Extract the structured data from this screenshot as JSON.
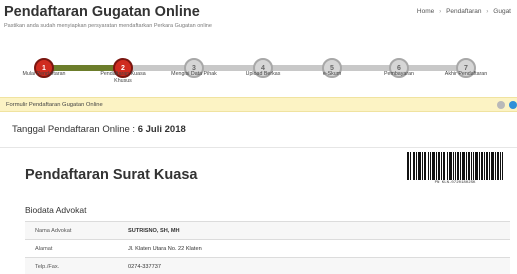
{
  "header": {
    "title": "Pendaftaran Gugatan Online",
    "subtitle": "Pastikan anda sudah menyiapkan persyaratan mendaftarkan Perkara Gugatan online",
    "breadcrumb": [
      "Home",
      "Pendaftaran",
      "Gugat"
    ]
  },
  "steps": [
    {
      "number": "1",
      "label": "Mulai Pendaftaran",
      "done": true
    },
    {
      "number": "2",
      "label": "Pendaftaran Kuasa Khusus",
      "done": true
    },
    {
      "number": "3",
      "label": "Mengisi Data Pihak",
      "done": false
    },
    {
      "number": "4",
      "label": "Upload Berkas",
      "done": false
    },
    {
      "number": "5",
      "label": "e-Skum",
      "done": false
    },
    {
      "number": "6",
      "label": "Pembayaran",
      "done": false
    },
    {
      "number": "7",
      "label": "Akhir Pendaftaran",
      "done": false
    }
  ],
  "form_bar": {
    "title": "Formulir Pendaftaran Gugatan Online"
  },
  "registration": {
    "date_label": "Tanggal Pendaftaran Online :",
    "date_value": "6 Juli 2018"
  },
  "section": {
    "title": "Pendaftaran Surat Kuasa",
    "barcode_text": "PN KLN-07201802SK",
    "sub_heading": "Biodata Advokat"
  },
  "table": {
    "rows": [
      {
        "label": "Nama Advokat",
        "value": "SUTRISNO, SH, MH"
      },
      {
        "label": "Alamat",
        "value": "Jl. Klaten Utara No. 22 Klaten"
      },
      {
        "label": "Telp./Fax.",
        "value": "0274-337737"
      }
    ]
  },
  "colors": {
    "step_done": "#cf2b1f",
    "step_line_done": "#6c7d2b",
    "step_todo": "#d6d6d6",
    "form_bar_bg": "#fcf3c4"
  }
}
